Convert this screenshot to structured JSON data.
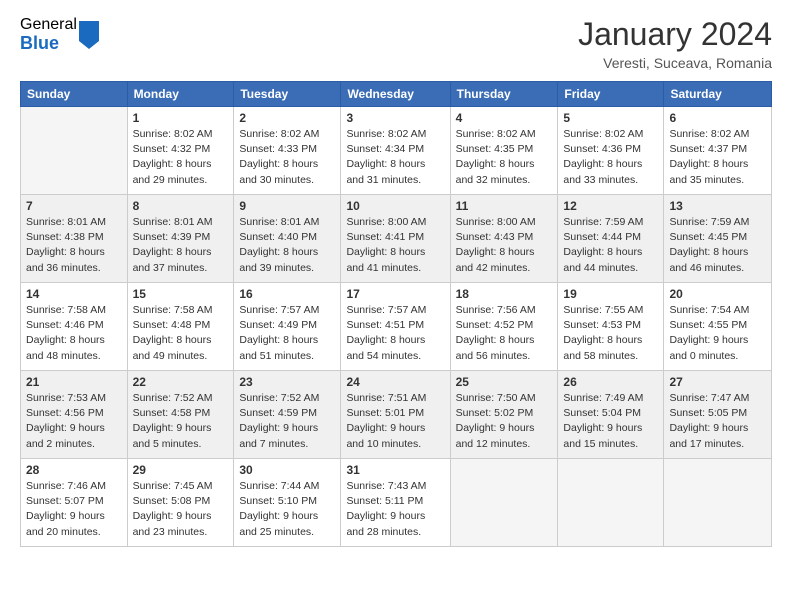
{
  "logo": {
    "general": "General",
    "blue": "Blue"
  },
  "header": {
    "title": "January 2024",
    "subtitle": "Veresti, Suceava, Romania"
  },
  "weekdays": [
    "Sunday",
    "Monday",
    "Tuesday",
    "Wednesday",
    "Thursday",
    "Friday",
    "Saturday"
  ],
  "weeks": [
    [
      {
        "day": "",
        "sunrise": "",
        "sunset": "",
        "daylight": ""
      },
      {
        "day": "1",
        "sunrise": "Sunrise: 8:02 AM",
        "sunset": "Sunset: 4:32 PM",
        "daylight": "Daylight: 8 hours and 29 minutes."
      },
      {
        "day": "2",
        "sunrise": "Sunrise: 8:02 AM",
        "sunset": "Sunset: 4:33 PM",
        "daylight": "Daylight: 8 hours and 30 minutes."
      },
      {
        "day": "3",
        "sunrise": "Sunrise: 8:02 AM",
        "sunset": "Sunset: 4:34 PM",
        "daylight": "Daylight: 8 hours and 31 minutes."
      },
      {
        "day": "4",
        "sunrise": "Sunrise: 8:02 AM",
        "sunset": "Sunset: 4:35 PM",
        "daylight": "Daylight: 8 hours and 32 minutes."
      },
      {
        "day": "5",
        "sunrise": "Sunrise: 8:02 AM",
        "sunset": "Sunset: 4:36 PM",
        "daylight": "Daylight: 8 hours and 33 minutes."
      },
      {
        "day": "6",
        "sunrise": "Sunrise: 8:02 AM",
        "sunset": "Sunset: 4:37 PM",
        "daylight": "Daylight: 8 hours and 35 minutes."
      }
    ],
    [
      {
        "day": "7",
        "sunrise": "Sunrise: 8:01 AM",
        "sunset": "Sunset: 4:38 PM",
        "daylight": "Daylight: 8 hours and 36 minutes."
      },
      {
        "day": "8",
        "sunrise": "Sunrise: 8:01 AM",
        "sunset": "Sunset: 4:39 PM",
        "daylight": "Daylight: 8 hours and 37 minutes."
      },
      {
        "day": "9",
        "sunrise": "Sunrise: 8:01 AM",
        "sunset": "Sunset: 4:40 PM",
        "daylight": "Daylight: 8 hours and 39 minutes."
      },
      {
        "day": "10",
        "sunrise": "Sunrise: 8:00 AM",
        "sunset": "Sunset: 4:41 PM",
        "daylight": "Daylight: 8 hours and 41 minutes."
      },
      {
        "day": "11",
        "sunrise": "Sunrise: 8:00 AM",
        "sunset": "Sunset: 4:43 PM",
        "daylight": "Daylight: 8 hours and 42 minutes."
      },
      {
        "day": "12",
        "sunrise": "Sunrise: 7:59 AM",
        "sunset": "Sunset: 4:44 PM",
        "daylight": "Daylight: 8 hours and 44 minutes."
      },
      {
        "day": "13",
        "sunrise": "Sunrise: 7:59 AM",
        "sunset": "Sunset: 4:45 PM",
        "daylight": "Daylight: 8 hours and 46 minutes."
      }
    ],
    [
      {
        "day": "14",
        "sunrise": "Sunrise: 7:58 AM",
        "sunset": "Sunset: 4:46 PM",
        "daylight": "Daylight: 8 hours and 48 minutes."
      },
      {
        "day": "15",
        "sunrise": "Sunrise: 7:58 AM",
        "sunset": "Sunset: 4:48 PM",
        "daylight": "Daylight: 8 hours and 49 minutes."
      },
      {
        "day": "16",
        "sunrise": "Sunrise: 7:57 AM",
        "sunset": "Sunset: 4:49 PM",
        "daylight": "Daylight: 8 hours and 51 minutes."
      },
      {
        "day": "17",
        "sunrise": "Sunrise: 7:57 AM",
        "sunset": "Sunset: 4:51 PM",
        "daylight": "Daylight: 8 hours and 54 minutes."
      },
      {
        "day": "18",
        "sunrise": "Sunrise: 7:56 AM",
        "sunset": "Sunset: 4:52 PM",
        "daylight": "Daylight: 8 hours and 56 minutes."
      },
      {
        "day": "19",
        "sunrise": "Sunrise: 7:55 AM",
        "sunset": "Sunset: 4:53 PM",
        "daylight": "Daylight: 8 hours and 58 minutes."
      },
      {
        "day": "20",
        "sunrise": "Sunrise: 7:54 AM",
        "sunset": "Sunset: 4:55 PM",
        "daylight": "Daylight: 9 hours and 0 minutes."
      }
    ],
    [
      {
        "day": "21",
        "sunrise": "Sunrise: 7:53 AM",
        "sunset": "Sunset: 4:56 PM",
        "daylight": "Daylight: 9 hours and 2 minutes."
      },
      {
        "day": "22",
        "sunrise": "Sunrise: 7:52 AM",
        "sunset": "Sunset: 4:58 PM",
        "daylight": "Daylight: 9 hours and 5 minutes."
      },
      {
        "day": "23",
        "sunrise": "Sunrise: 7:52 AM",
        "sunset": "Sunset: 4:59 PM",
        "daylight": "Daylight: 9 hours and 7 minutes."
      },
      {
        "day": "24",
        "sunrise": "Sunrise: 7:51 AM",
        "sunset": "Sunset: 5:01 PM",
        "daylight": "Daylight: 9 hours and 10 minutes."
      },
      {
        "day": "25",
        "sunrise": "Sunrise: 7:50 AM",
        "sunset": "Sunset: 5:02 PM",
        "daylight": "Daylight: 9 hours and 12 minutes."
      },
      {
        "day": "26",
        "sunrise": "Sunrise: 7:49 AM",
        "sunset": "Sunset: 5:04 PM",
        "daylight": "Daylight: 9 hours and 15 minutes."
      },
      {
        "day": "27",
        "sunrise": "Sunrise: 7:47 AM",
        "sunset": "Sunset: 5:05 PM",
        "daylight": "Daylight: 9 hours and 17 minutes."
      }
    ],
    [
      {
        "day": "28",
        "sunrise": "Sunrise: 7:46 AM",
        "sunset": "Sunset: 5:07 PM",
        "daylight": "Daylight: 9 hours and 20 minutes."
      },
      {
        "day": "29",
        "sunrise": "Sunrise: 7:45 AM",
        "sunset": "Sunset: 5:08 PM",
        "daylight": "Daylight: 9 hours and 23 minutes."
      },
      {
        "day": "30",
        "sunrise": "Sunrise: 7:44 AM",
        "sunset": "Sunset: 5:10 PM",
        "daylight": "Daylight: 9 hours and 25 minutes."
      },
      {
        "day": "31",
        "sunrise": "Sunrise: 7:43 AM",
        "sunset": "Sunset: 5:11 PM",
        "daylight": "Daylight: 9 hours and 28 minutes."
      },
      {
        "day": "",
        "sunrise": "",
        "sunset": "",
        "daylight": ""
      },
      {
        "day": "",
        "sunrise": "",
        "sunset": "",
        "daylight": ""
      },
      {
        "day": "",
        "sunrise": "",
        "sunset": "",
        "daylight": ""
      }
    ]
  ]
}
